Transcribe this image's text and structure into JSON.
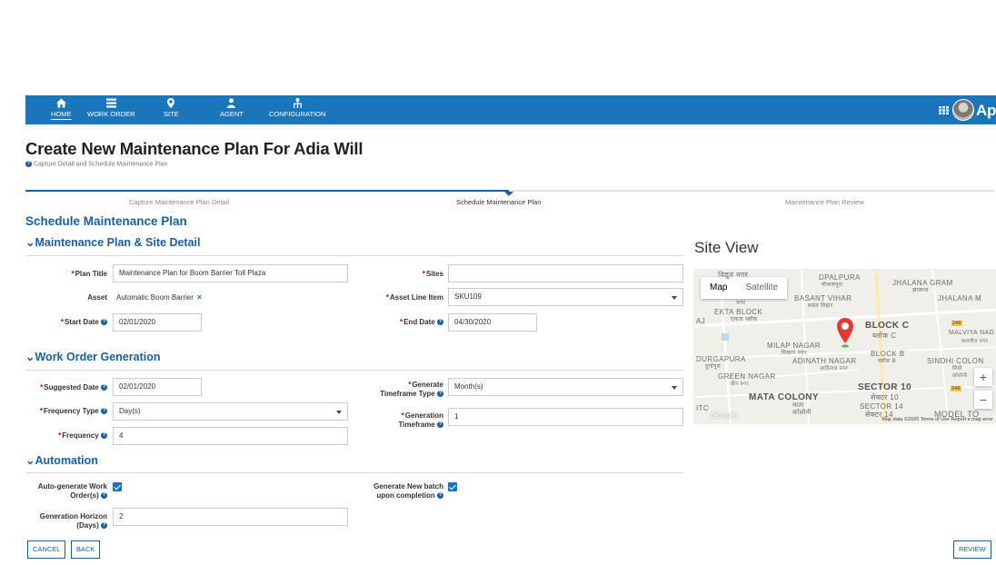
{
  "nav": {
    "items": [
      {
        "label": "HOME",
        "icon": "home-icon"
      },
      {
        "label": "WORK ORDER",
        "icon": "list-icon"
      },
      {
        "label": "SITE",
        "icon": "location-pin-icon"
      },
      {
        "label": "AGENT",
        "icon": "user-icon"
      },
      {
        "label": "CONFIGURATION",
        "icon": "hierarchy-icon"
      }
    ],
    "brand": "Appi",
    "bar_color": "#1b75bb"
  },
  "page": {
    "title": "Create New Maintenance Plan For Adia Will",
    "subtitle": "Capture Detail and Schedule Maintenance Plan"
  },
  "wizard": {
    "steps": [
      "Capture Maintenance Plan Detail",
      "Schedule Maintenance Plan",
      "Maintenance Plan Review"
    ],
    "active_step": "Schedule Maintenance Plan"
  },
  "schedule": {
    "heading": "Schedule Maintenance Plan",
    "site_section": "Maintenance Plan & Site Detail",
    "plan_title_label": "Plan Title",
    "plan_title_value": "Maintenance Plan for Boom Barrier Toll Plaza",
    "sites_label": "Sites",
    "sites_value": "",
    "asset_label": "Asset",
    "asset_value": "Automatic Boom Barrier",
    "asset_line_label": "Asset Line Item",
    "asset_line_value": "SKU109",
    "start_date_label": "Start Date",
    "start_date_value": "02/01/2020",
    "end_date_label": "End Date",
    "end_date_value": "04/30/2020"
  },
  "work_order": {
    "heading": "Work Order Generation",
    "suggested_date_label": "Suggested Date",
    "suggested_date_value": "02/01/2020",
    "timeframe_type_label_1": "Generate",
    "timeframe_type_label_2": "Timeframe Type",
    "timeframe_type_value": "Month(s)",
    "frequency_type_label": "Frequency Type",
    "frequency_type_value": "Day(s)",
    "generation_timeframe_label_1": "Generation",
    "generation_timeframe_label_2": "Timeframe",
    "generation_timeframe_value": "1",
    "frequency_label": "Frequency",
    "frequency_value": "4"
  },
  "automation": {
    "heading": "Automation",
    "auto_generate_label_1": "Auto-generate Work",
    "auto_generate_label_2": "Order(s)",
    "auto_generate_checked": true,
    "new_batch_label_1": "Generate New batch",
    "new_batch_label_2": "upon completion",
    "new_batch_checked": true,
    "horizon_label_1": "Generation Horizon",
    "horizon_label_2": "(Days)",
    "horizon_value": "2"
  },
  "map": {
    "title": "Site View",
    "tab_map": "Map",
    "tab_satellite": "Satellite",
    "zoom_in": "+",
    "zoom_out": "−",
    "labels": {
      "dpalpura": "DPALPURA",
      "dpalpura_hi": "गोपालपुरा",
      "jhalana_gram": "JHALANA GRAM",
      "jhalana_gram_hi": "झालाना",
      "jhalana_m": "JHALANA M",
      "vidyut": "विद्युत नगर",
      "basant_vihar": "BASANT VIHAR",
      "basant_vihar_hi": "बसंत विहार",
      "nagar_hi": "नगर",
      "ekta_block": "EKTA BLOCK",
      "ekta_hi": "एकता ब्लॉक",
      "aj": "AJ",
      "block_c": "BLOCK C",
      "block_c_hi": "ब्लॉक C",
      "malviya": "MALVIYA NAG",
      "malviya_hi": "मालवीय नगर",
      "milap": "MILAP NAGAR",
      "milap_hi": "मिलाप नगर",
      "block_b": "BLOCK B",
      "block_b_hi": "ब्लॉक B",
      "durgapura": "DURGAPURA",
      "durgapura_hi": "दुर्गापुरा",
      "adinath": "ADINATH NAGAR",
      "adinath_hi": "आदिनाथ नगर",
      "sindhi": "SINDHI COLON",
      "sindhi_hi": "सिंधी कॉलोनी",
      "green": "GREEN NAGAR",
      "green_hi": "ग्रीन नगर",
      "sector10": "SECTOR 10",
      "sector10_hi": "सेक्टर 10",
      "mata": "MATA COLONY",
      "mata_hi": "माता कॉलोनी",
      "sector14": "SECTOR 14",
      "sector14_hi": "सेक्टर 14",
      "model": "MODEL TO",
      "itc": "ITC",
      "badge_248": "248"
    },
    "google": "Google",
    "footer": "Map data ©2020   Terms of Use   Report a map error"
  },
  "buttons": {
    "cancel": "CANCEL",
    "back": "BACK",
    "review": "REVIEW"
  }
}
